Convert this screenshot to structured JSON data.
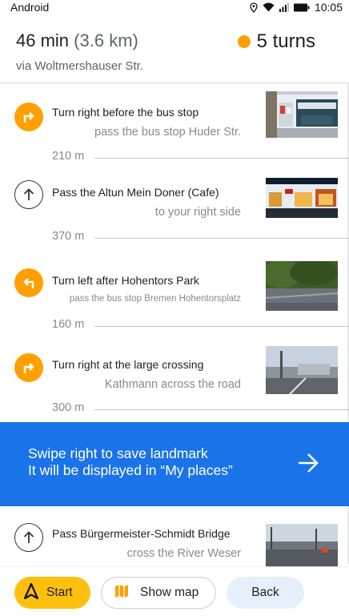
{
  "status_bar": {
    "os_label": "Android",
    "time": "10:05",
    "icons": [
      "location-icon",
      "wifi-icon",
      "signal-icon",
      "battery-icon"
    ]
  },
  "summary": {
    "duration": "46 min",
    "distance": "(3.6 km)",
    "via": "via Woltmershauser Str.",
    "turns": "5 turns"
  },
  "steps": [
    {
      "icon": "turn-right-icon",
      "title": "Turn right before the bus stop",
      "hint": "pass the bus stop Huder Str.",
      "distance": "210 m"
    },
    {
      "icon": "straight-arrow-icon",
      "title": "Pass the Altun Mein Doner (Cafe)",
      "hint": "to your right side",
      "distance": "370 m"
    },
    {
      "icon": "turn-left-icon",
      "title": "Turn left after Hohentors Park",
      "hint": "pass the bus stop Bremen Hohentorsplatz",
      "distance": "160 m"
    },
    {
      "icon": "turn-right-icon",
      "title": "Turn right at the large crossing",
      "hint": "Kathmann across the road",
      "distance": "300 m"
    },
    {
      "icon": "straight-arrow-icon",
      "title": "Pass Bürgermeister-Schmidt Bridge",
      "hint": "cross the River Weser"
    }
  ],
  "banner": {
    "line1": "Swipe right to save landmark",
    "line2": "It will be displayed in “My places”"
  },
  "bottom_bar": {
    "start_label": "Start",
    "map_label": "Show map",
    "back_label": "Back"
  },
  "colors": {
    "accent_orange": "#ffa000",
    "start_yellow": "#ffbf0d",
    "banner_blue": "#1a73e8",
    "back_bg": "#e6f0fc"
  }
}
